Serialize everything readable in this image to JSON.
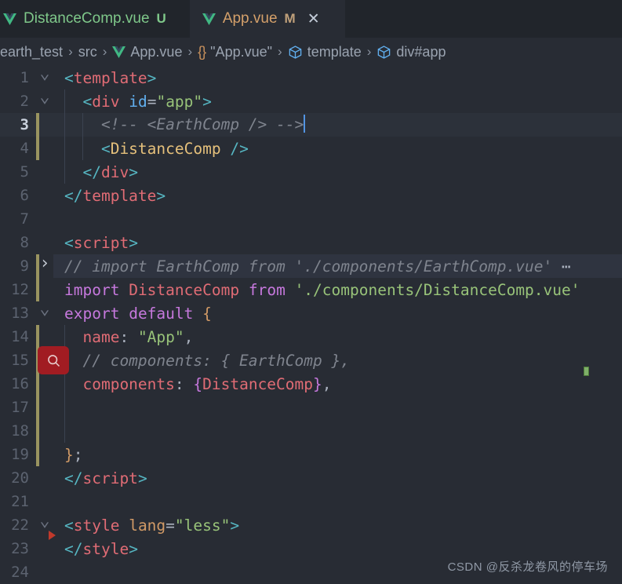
{
  "tabs": [
    {
      "label": "DistanceComp.vue",
      "badge": "U",
      "icon": "vue-icon",
      "active": false,
      "closable": false
    },
    {
      "label": "App.vue",
      "badge": "M",
      "icon": "vue-icon",
      "active": true,
      "closable": true,
      "close_glyph": "✕"
    }
  ],
  "breadcrumb": {
    "items": [
      {
        "label": "earth_test",
        "icon": null
      },
      {
        "label": "src",
        "icon": null
      },
      {
        "label": "App.vue",
        "icon": "vue-icon"
      },
      {
        "label": "\"App.vue\"",
        "icon": "braces-icon"
      },
      {
        "label": "template",
        "icon": "cube-icon"
      },
      {
        "label": "div#app",
        "icon": "cube-icon"
      }
    ],
    "separator": "›"
  },
  "editor": {
    "language": "vue",
    "active_line": 3,
    "lines": [
      {
        "num": "1",
        "fold": "down",
        "modified": false,
        "indent": 0,
        "tokens": [
          {
            "t": "<",
            "c": "t-angle"
          },
          {
            "t": "template",
            "c": "t-tag"
          },
          {
            "t": ">",
            "c": "t-angle"
          }
        ]
      },
      {
        "num": "2",
        "fold": "down",
        "modified": false,
        "indent": 1,
        "tokens": [
          {
            "t": "  <",
            "c": "t-angle"
          },
          {
            "t": "div",
            "c": "t-tag"
          },
          {
            "t": " ",
            "c": "t-plain"
          },
          {
            "t": "id",
            "c": "t-attr2"
          },
          {
            "t": "=",
            "c": "t-plain"
          },
          {
            "t": "\"app\"",
            "c": "t-str"
          },
          {
            "t": ">",
            "c": "t-angle"
          }
        ]
      },
      {
        "num": "3",
        "fold": null,
        "modified": true,
        "indent": 2,
        "active": true,
        "cursor": true,
        "tokens": [
          {
            "t": "    <!-- <EarthComp /> -->",
            "c": "t-comment"
          }
        ]
      },
      {
        "num": "4",
        "fold": null,
        "modified": true,
        "indent": 2,
        "tokens": [
          {
            "t": "    <",
            "c": "t-angle"
          },
          {
            "t": "DistanceComp",
            "c": "t-comp"
          },
          {
            "t": " />",
            "c": "t-angle"
          }
        ]
      },
      {
        "num": "5",
        "fold": null,
        "modified": false,
        "indent": 1,
        "tokens": [
          {
            "t": "  </",
            "c": "t-angle"
          },
          {
            "t": "div",
            "c": "t-tag"
          },
          {
            "t": ">",
            "c": "t-angle"
          }
        ]
      },
      {
        "num": "6",
        "fold": null,
        "modified": false,
        "indent": 0,
        "tokens": [
          {
            "t": "</",
            "c": "t-angle"
          },
          {
            "t": "template",
            "c": "t-tag"
          },
          {
            "t": ">",
            "c": "t-angle"
          }
        ]
      },
      {
        "num": "7",
        "fold": null,
        "modified": false,
        "indent": 0,
        "tokens": []
      },
      {
        "num": "8",
        "fold": null,
        "modified": false,
        "indent": 0,
        "tokens": [
          {
            "t": "<",
            "c": "t-angle"
          },
          {
            "t": "script",
            "c": "t-tag"
          },
          {
            "t": ">",
            "c": "t-angle"
          }
        ]
      },
      {
        "num": "9",
        "fold": "right",
        "modified": true,
        "indent": 0,
        "folded": true,
        "tokens": [
          {
            "t": "// import EarthComp from './components/EarthComp.vue'",
            "c": "t-comment"
          },
          {
            "t": " ⋯",
            "c": "t-plain"
          }
        ]
      },
      {
        "num": "12",
        "fold": null,
        "modified": true,
        "indent": 0,
        "tokens": [
          {
            "t": "import",
            "c": "t-kw"
          },
          {
            "t": " ",
            "c": "t-plain"
          },
          {
            "t": "DistanceComp",
            "c": "t-prop"
          },
          {
            "t": " ",
            "c": "t-plain"
          },
          {
            "t": "from",
            "c": "t-kw"
          },
          {
            "t": " ",
            "c": "t-plain"
          },
          {
            "t": "'./components/DistanceComp.vue'",
            "c": "t-str"
          }
        ]
      },
      {
        "num": "13",
        "fold": "down",
        "modified": false,
        "indent": 0,
        "tokens": [
          {
            "t": "export",
            "c": "t-kw"
          },
          {
            "t": " ",
            "c": "t-plain"
          },
          {
            "t": "default",
            "c": "t-kw"
          },
          {
            "t": " ",
            "c": "t-plain"
          },
          {
            "t": "{",
            "c": "t-brace"
          }
        ]
      },
      {
        "num": "14",
        "fold": null,
        "modified": true,
        "indent": 1,
        "tokens": [
          {
            "t": "  name",
            "c": "t-prop"
          },
          {
            "t": ": ",
            "c": "t-plain"
          },
          {
            "t": "\"App\"",
            "c": "t-str"
          },
          {
            "t": ",",
            "c": "t-plain"
          }
        ]
      },
      {
        "num": "15",
        "fold": null,
        "modified": true,
        "indent": 1,
        "marker": "search",
        "tokens": [
          {
            "t": "  // components: { EarthComp },",
            "c": "t-comment"
          }
        ]
      },
      {
        "num": "16",
        "fold": null,
        "modified": true,
        "indent": 1,
        "tokens": [
          {
            "t": "  components",
            "c": "t-prop"
          },
          {
            "t": ": ",
            "c": "t-plain"
          },
          {
            "t": "{",
            "c": "t-brace2"
          },
          {
            "t": "DistanceComp",
            "c": "t-prop"
          },
          {
            "t": "}",
            "c": "t-brace2"
          },
          {
            "t": ",",
            "c": "t-plain"
          }
        ]
      },
      {
        "num": "17",
        "fold": null,
        "modified": true,
        "indent": 1,
        "tokens": []
      },
      {
        "num": "18",
        "fold": null,
        "modified": true,
        "indent": 1,
        "tokens": []
      },
      {
        "num": "19",
        "fold": null,
        "modified": true,
        "indent": 0,
        "tokens": [
          {
            "t": "}",
            "c": "t-brace"
          },
          {
            "t": ";",
            "c": "t-plain"
          }
        ]
      },
      {
        "num": "20",
        "fold": null,
        "modified": false,
        "indent": 0,
        "tokens": [
          {
            "t": "</",
            "c": "t-angle"
          },
          {
            "t": "script",
            "c": "t-tag"
          },
          {
            "t": ">",
            "c": "t-angle"
          }
        ]
      },
      {
        "num": "21",
        "fold": null,
        "modified": false,
        "indent": 0,
        "tokens": []
      },
      {
        "num": "22",
        "fold": "down",
        "modified": false,
        "indent": 0,
        "tokens": [
          {
            "t": "<",
            "c": "t-angle"
          },
          {
            "t": "style",
            "c": "t-tag"
          },
          {
            "t": " ",
            "c": "t-plain"
          },
          {
            "t": "lang",
            "c": "t-attr"
          },
          {
            "t": "=",
            "c": "t-plain"
          },
          {
            "t": "\"less\"",
            "c": "t-str"
          },
          {
            "t": ">",
            "c": "t-angle"
          }
        ]
      },
      {
        "num": "23",
        "fold": null,
        "modified": false,
        "indent": 0,
        "marker": "triangle",
        "tokens": [
          {
            "t": "</",
            "c": "t-angle"
          },
          {
            "t": "style",
            "c": "t-tag"
          },
          {
            "t": ">",
            "c": "t-angle"
          }
        ]
      },
      {
        "num": "24",
        "fold": null,
        "modified": false,
        "indent": 0,
        "tokens": []
      }
    ]
  },
  "watermark": {
    "text": "CSDN @反杀龙卷风的停车场"
  },
  "colors": {
    "editor_bg": "#282c34",
    "tabbar_bg": "#21252b",
    "active_line_bg": "#2c313a",
    "folded_bg": "#2f3440",
    "modified_bar": "#9a9460",
    "marker_red": "#a11c22",
    "accent_blue": "#61afef",
    "vue_green": "#41b883"
  }
}
